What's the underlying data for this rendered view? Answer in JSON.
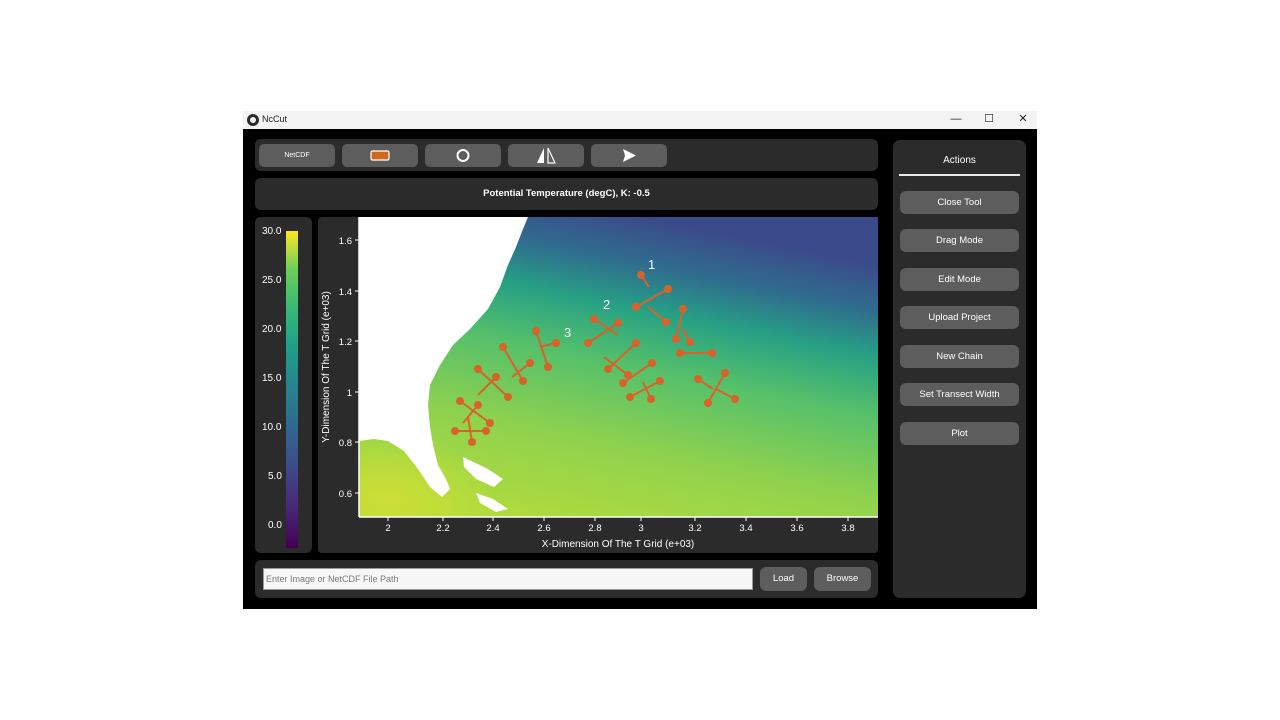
{
  "window": {
    "title": "NcCut",
    "minimize": "—",
    "maximize": "☐",
    "close": "✕"
  },
  "toolbar": {
    "netcdf_label": "NetCDF",
    "rect_icon": "rectangle-icon",
    "circle_icon": "circle-icon",
    "flip_icon": "flip-icon",
    "send_icon": "send-icon"
  },
  "plot_title": "Potential Temperature (degC), K: -0.5",
  "colorbar": {
    "ticks": [
      "30.0",
      "25.0",
      "20.0",
      "15.0",
      "10.0",
      "5.0",
      "0.0"
    ]
  },
  "chart_data": {
    "type": "heatmap",
    "xlabel": "X-Dimension Of The T Grid (e+03)",
    "ylabel": "Y-Dimension Of The T Grid (e+03)",
    "x_ticks": [
      "2",
      "2.2",
      "2.4",
      "2.6",
      "2.8",
      "3",
      "3.2",
      "3.4",
      "3.6",
      "3.8"
    ],
    "y_ticks": [
      "1.6",
      "1.4",
      "1.2",
      "1",
      "0.8",
      "0.6"
    ],
    "xlim": [
      1.89,
      3.92
    ],
    "ylim": [
      0.5,
      1.7
    ],
    "transect_labels": [
      "1",
      "2",
      "3"
    ]
  },
  "bottom": {
    "path_placeholder": "Enter Image or NetCDF File Path",
    "load_label": "Load",
    "browse_label": "Browse"
  },
  "sidebar": {
    "title": "Actions",
    "buttons": [
      "Close Tool",
      "Drag Mode",
      "Edit Mode",
      "Upload Project",
      "New Chain",
      "Set Transect Width",
      "Plot"
    ]
  }
}
